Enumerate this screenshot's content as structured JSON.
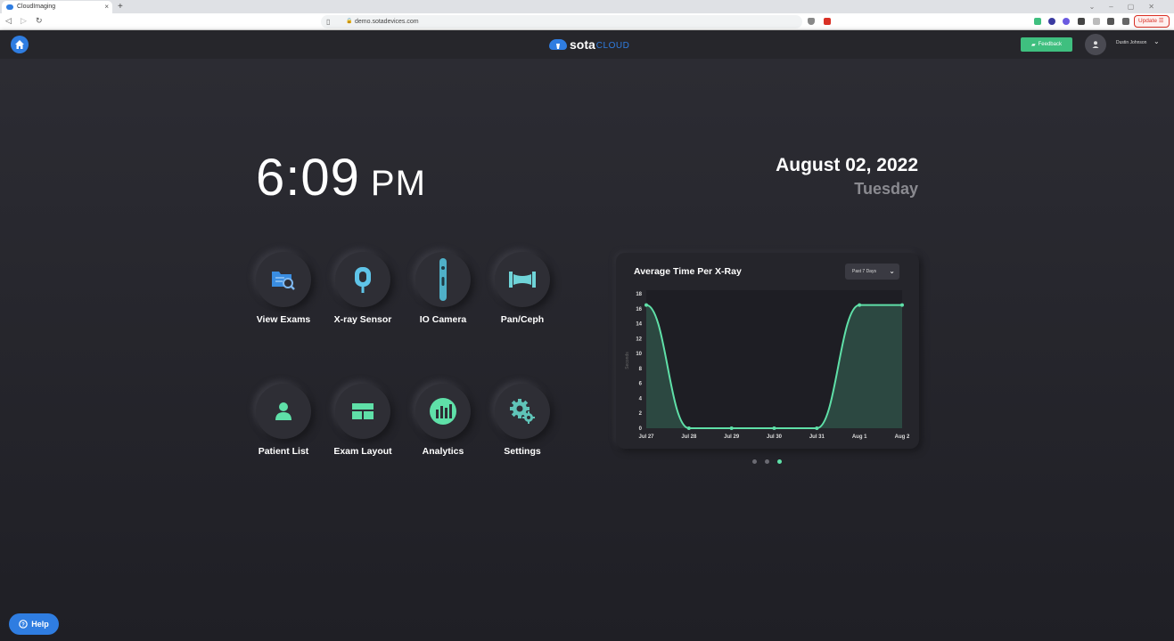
{
  "browser": {
    "tab_title": "CloudImaging",
    "new_tab": "+",
    "tab_close": "×",
    "url": "demo.sotadevices.com",
    "update_label": "Update"
  },
  "header": {
    "logo_sota": "sota",
    "logo_cloud": "CLOUD",
    "feedback_label": "Feedback",
    "user_name": "Dustin Johnson"
  },
  "main": {
    "time": "6:09",
    "ampm": "PM",
    "date": "August 02, 2022",
    "day": "Tuesday",
    "tiles": [
      {
        "label": "View Exams",
        "icon": "folder-search-icon"
      },
      {
        "label": "X-ray Sensor",
        "icon": "xray-sensor-icon"
      },
      {
        "label": "IO Camera",
        "icon": "io-camera-icon"
      },
      {
        "label": "Pan/Ceph",
        "icon": "pan-ceph-icon"
      },
      {
        "label": "Patient List",
        "icon": "patient-icon"
      },
      {
        "label": "Exam Layout",
        "icon": "layout-icon"
      },
      {
        "label": "Analytics",
        "icon": "analytics-icon"
      },
      {
        "label": "Settings",
        "icon": "settings-icon"
      }
    ]
  },
  "chart_card": {
    "title": "Average Time Per X-Ray",
    "range_label": "Past 7 Days"
  },
  "chart_data": {
    "type": "area",
    "title": "Average Time Per X-Ray",
    "ylabel": "Seconds",
    "categories": [
      "Jul 27",
      "Jul 28",
      "Jul 29",
      "Jul 30",
      "Jul 31",
      "Aug 1",
      "Aug 2"
    ],
    "values": [
      16.5,
      0,
      0,
      0,
      0,
      16.5,
      16.5
    ],
    "yticks": [
      0,
      2,
      4,
      6,
      8,
      10,
      12,
      14,
      16,
      18
    ],
    "ylim": [
      0,
      18
    ],
    "color": "#5fe0a8"
  },
  "help_label": "Help",
  "colors": {
    "accent_blue": "#2f7de1",
    "accent_green": "#5fe0a8",
    "feedback_green": "#3fbf7f"
  }
}
